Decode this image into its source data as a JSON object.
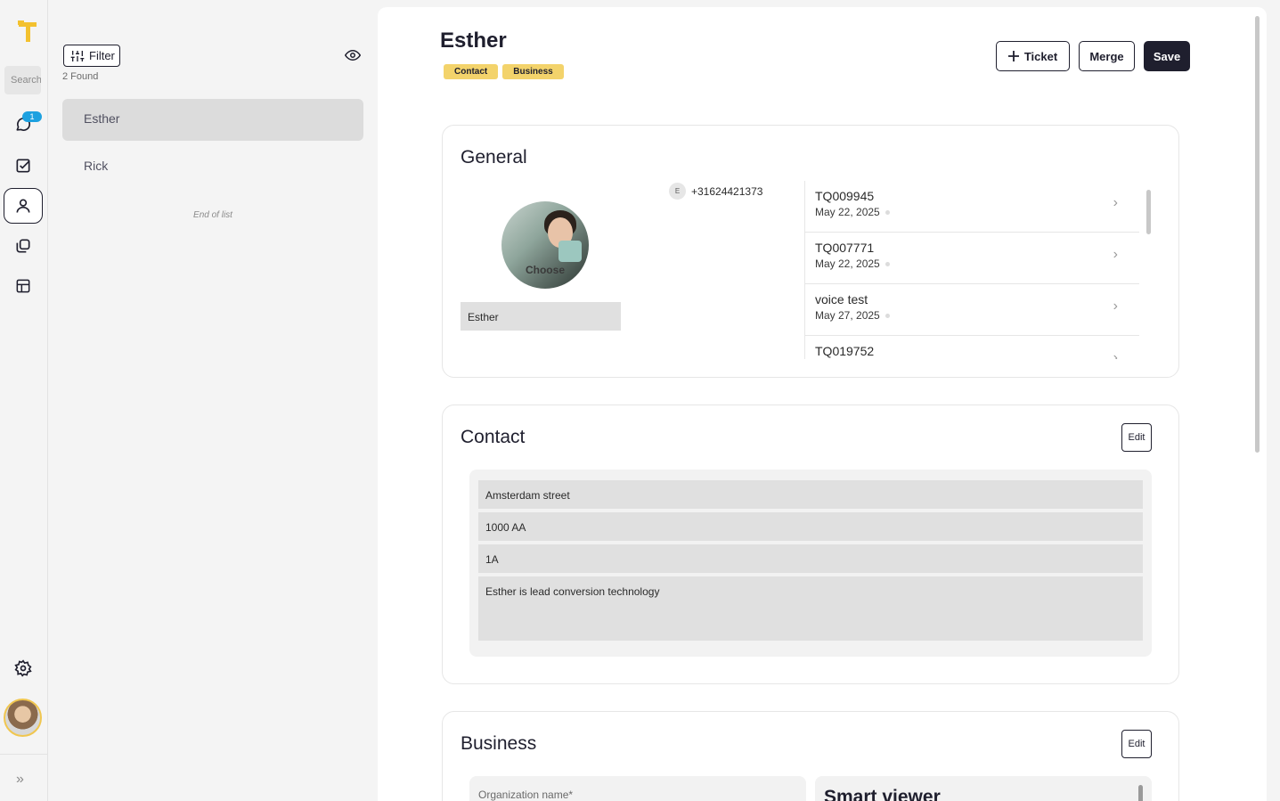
{
  "rail": {
    "search_placeholder": "Search",
    "chat_badge": "1",
    "expand_glyph": "»"
  },
  "list": {
    "filter_label": "Filter",
    "found_text": "2 Found",
    "items": [
      "Esther",
      "Rick"
    ],
    "end_text": "End of list"
  },
  "header": {
    "title": "Esther",
    "tags": [
      "Contact",
      "Business"
    ],
    "ticket_label": "Ticket",
    "merge_label": "Merge",
    "save_label": "Save"
  },
  "general": {
    "heading": "General",
    "photo_label": "Choose",
    "name_value": "Esther",
    "phone_initial": "E",
    "phone": "+31624421373",
    "tickets": [
      {
        "id": "TQ009945",
        "date": "May 22, 2025"
      },
      {
        "id": "TQ007771",
        "date": "May 22, 2025"
      },
      {
        "id": "voice test",
        "date": "May 27, 2025"
      },
      {
        "id": "TQ019752",
        "date": ""
      }
    ]
  },
  "contact": {
    "heading": "Contact",
    "edit_label": "Edit",
    "street": "Amsterdam street",
    "postal": "1000 AA",
    "number": "1A",
    "note": "Esther is lead conversion technology"
  },
  "business": {
    "heading": "Business",
    "edit_label": "Edit",
    "org_placeholder": "Organization name*",
    "smart_viewer": "Smart viewer"
  },
  "colors": {
    "accent": "#f3c12e",
    "tag": "#f3d36b",
    "dark": "#1f1f2e",
    "badge": "#1da1e0"
  }
}
